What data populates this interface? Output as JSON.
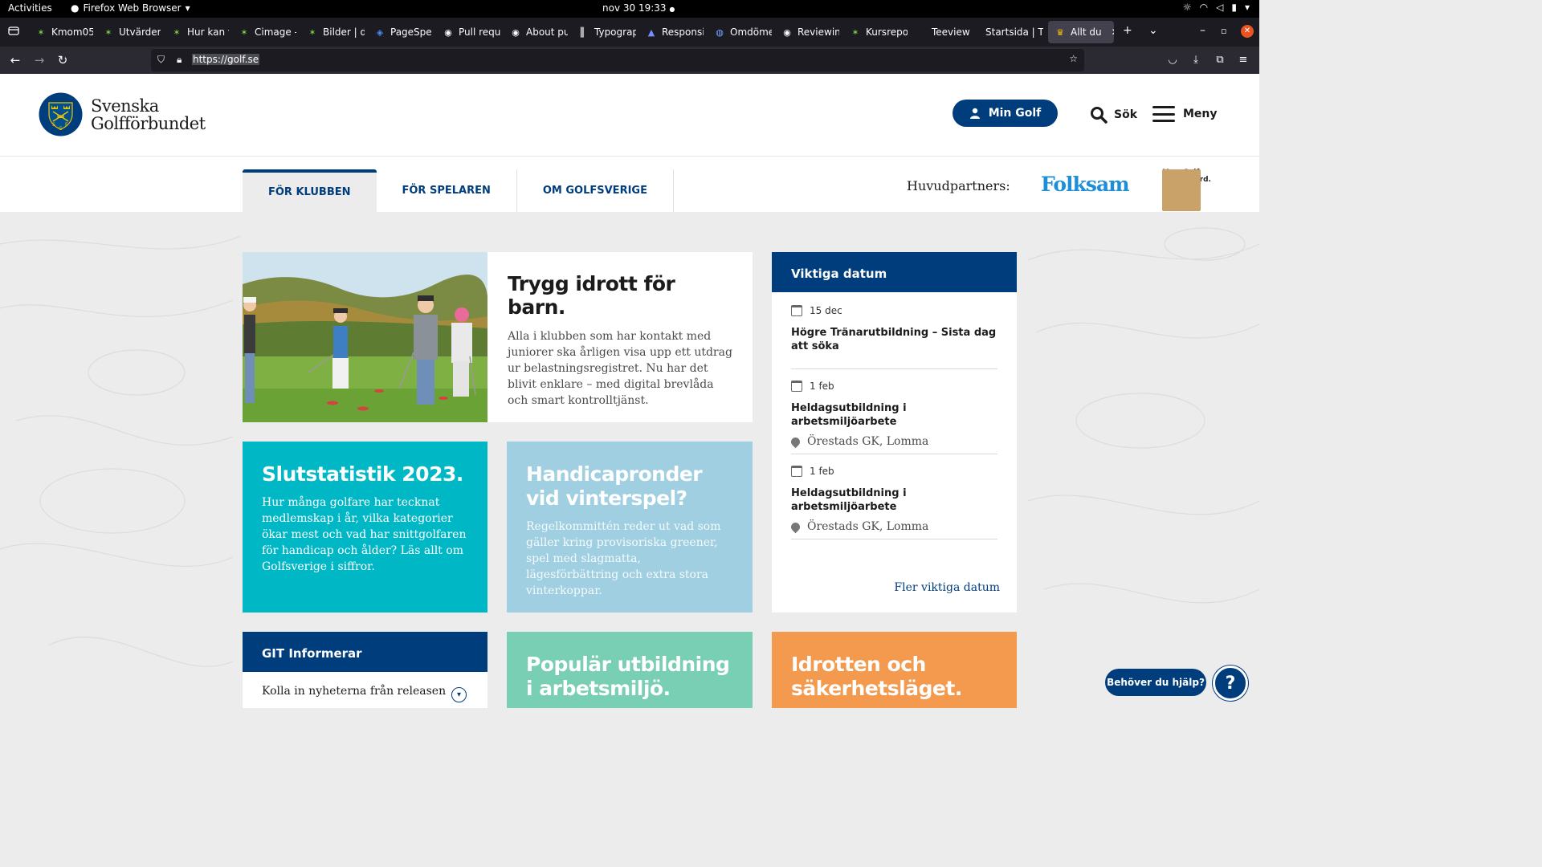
{
  "system": {
    "activities": "Activities",
    "app_name": "Firefox Web Browser",
    "clock": "nov 30  19:33"
  },
  "browser": {
    "tabs": [
      {
        "label": "Kmom05"
      },
      {
        "label": "Utvärder"
      },
      {
        "label": "Hur kan v"
      },
      {
        "label": "Cimage -"
      },
      {
        "label": "Bilder | d"
      },
      {
        "label": "PageSpe"
      },
      {
        "label": "Pull requ"
      },
      {
        "label": "About pu"
      },
      {
        "label": "Typograp"
      },
      {
        "label": "Responsi"
      },
      {
        "label": "Omdöme"
      },
      {
        "label": "Reviewin"
      },
      {
        "label": "Kursrepo"
      },
      {
        "label": "Teeview"
      },
      {
        "label": "Startsida | T"
      },
      {
        "label": "Allt du"
      }
    ],
    "url": "https://golf.se"
  },
  "header": {
    "logo_line1": "Svenska",
    "logo_line2": "Golfförbundet",
    "min_golf": "Min Golf",
    "search": "Sök",
    "menu": "Meny"
  },
  "subnav": {
    "tabs": [
      "FÖR KLUBBEN",
      "FÖR SPELAREN",
      "OM GOLFSVERIGE"
    ],
    "partners_label": "Huvudpartners:",
    "partner1": "Folksam",
    "partner2_line1": "MoreGolf",
    "partner2_line2": "Mastercard."
  },
  "hero": {
    "title": "Trygg idrott för barn.",
    "body": "Alla i klubben som har kontakt med juniorer ska årligen visa upp ett utdrag ur belastningsregistret. Nu har det blivit enklare – med digital brevlåda och smart kontrolltjänst."
  },
  "dates": {
    "heading": "Viktiga datum",
    "items": [
      {
        "date": "15 dec",
        "title": "Högre Tränarutbildning – Sista dag att söka",
        "location": ""
      },
      {
        "date": "1 feb",
        "title": "Heldagsutbildning i arbetsmiljöarbete",
        "location": "Örestads GK, Lomma"
      },
      {
        "date": "1 feb",
        "title": "Heldagsutbildning i arbetsmiljöarbete",
        "location": "Örestads GK, Lomma"
      }
    ],
    "more": "Fler viktiga datum"
  },
  "cards": {
    "stats": {
      "title": "Slutstatistik 2023.",
      "body": "Hur många golfare har tecknat medlemskap i år, vilka kategorier ökar mest och vad har snittgolfaren för handicap och ålder? Läs allt om Golfsverige i siffror."
    },
    "handicap": {
      "title": "Handicapronder vid vinterspel?",
      "body": "Regelkommittén reder ut vad som gäller kring provisoriska greener, spel med slagmatta, lägesförbättring och extra stora vinterkoppar."
    },
    "edu": {
      "title": "Populär utbildning i arbetsmiljö."
    },
    "safety": {
      "title": "Idrotten och säkerhetsläget."
    }
  },
  "git": {
    "heading": "GIT Informerar",
    "row": "Kolla in nyheterna från releasen"
  },
  "help": {
    "label": "Behöver du hjälp?",
    "icon": "?"
  },
  "colors": {
    "brand_blue": "#003d7c",
    "teal": "#00b7c6",
    "light_blue": "#9fcfe0",
    "mint": "#79cfb3",
    "orange": "#f39a4f",
    "folksam": "#1d8fd6"
  }
}
